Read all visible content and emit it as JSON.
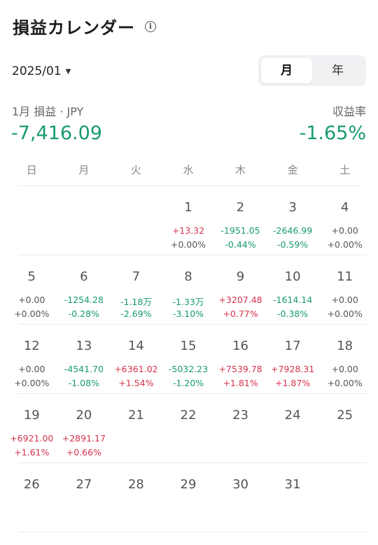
{
  "header": {
    "title": "損益カレンダー",
    "info_icon": "info-icon"
  },
  "month_select": {
    "value": "2025/01"
  },
  "segment": {
    "month": "月",
    "year": "年"
  },
  "summary": {
    "label": "1月 損益 · JPY",
    "rate_label": "収益率",
    "pnl": "-7,416.09",
    "rate": "-1.65%"
  },
  "weekdays": [
    "日",
    "月",
    "火",
    "水",
    "木",
    "金",
    "土"
  ],
  "weeks": [
    [
      {
        "day": "",
        "pnl": "",
        "pct": "",
        "tone": ""
      },
      {
        "day": "",
        "pnl": "",
        "pct": "",
        "tone": ""
      },
      {
        "day": "",
        "pnl": "",
        "pct": "",
        "tone": ""
      },
      {
        "day": "1",
        "pnl": "+13.32",
        "pct": "+0.00%",
        "tone": "red",
        "pct_tone": "gray"
      },
      {
        "day": "2",
        "pnl": "-1951.05",
        "pct": "-0.44%",
        "tone": "green"
      },
      {
        "day": "3",
        "pnl": "-2646.99",
        "pct": "-0.59%",
        "tone": "green"
      },
      {
        "day": "4",
        "pnl": "+0.00",
        "pct": "+0.00%",
        "tone": "gray"
      }
    ],
    [
      {
        "day": "5",
        "pnl": "+0.00",
        "pct": "+0.00%",
        "tone": "gray"
      },
      {
        "day": "6",
        "pnl": "-1254.28",
        "pct": "-0.28%",
        "tone": "green"
      },
      {
        "day": "7",
        "pnl": "-1.18万",
        "pct": "-2.69%",
        "tone": "green"
      },
      {
        "day": "8",
        "pnl": "-1.33万",
        "pct": "-3.10%",
        "tone": "green"
      },
      {
        "day": "9",
        "pnl": "+3207.48",
        "pct": "+0.77%",
        "tone": "red"
      },
      {
        "day": "10",
        "pnl": "-1614.14",
        "pct": "-0.38%",
        "tone": "green"
      },
      {
        "day": "11",
        "pnl": "+0.00",
        "pct": "+0.00%",
        "tone": "gray"
      }
    ],
    [
      {
        "day": "12",
        "pnl": "+0.00",
        "pct": "+0.00%",
        "tone": "gray"
      },
      {
        "day": "13",
        "pnl": "-4541.70",
        "pct": "-1.08%",
        "tone": "green"
      },
      {
        "day": "14",
        "pnl": "+6361.02",
        "pct": "+1.54%",
        "tone": "red"
      },
      {
        "day": "15",
        "pnl": "-5032.23",
        "pct": "-1.20%",
        "tone": "green"
      },
      {
        "day": "16",
        "pnl": "+7539.78",
        "pct": "+1.81%",
        "tone": "red"
      },
      {
        "day": "17",
        "pnl": "+7928.31",
        "pct": "+1.87%",
        "tone": "red"
      },
      {
        "day": "18",
        "pnl": "+0.00",
        "pct": "+0.00%",
        "tone": "gray"
      }
    ],
    [
      {
        "day": "19",
        "pnl": "+6921.00",
        "pct": "+1.61%",
        "tone": "red"
      },
      {
        "day": "20",
        "pnl": "+2891.17",
        "pct": "+0.66%",
        "tone": "red"
      },
      {
        "day": "21",
        "pnl": "",
        "pct": "",
        "tone": ""
      },
      {
        "day": "22",
        "pnl": "",
        "pct": "",
        "tone": ""
      },
      {
        "day": "23",
        "pnl": "",
        "pct": "",
        "tone": ""
      },
      {
        "day": "24",
        "pnl": "",
        "pct": "",
        "tone": ""
      },
      {
        "day": "25",
        "pnl": "",
        "pct": "",
        "tone": ""
      }
    ],
    [
      {
        "day": "26",
        "pnl": "",
        "pct": "",
        "tone": ""
      },
      {
        "day": "27",
        "pnl": "",
        "pct": "",
        "tone": ""
      },
      {
        "day": "28",
        "pnl": "",
        "pct": "",
        "tone": ""
      },
      {
        "day": "29",
        "pnl": "",
        "pct": "",
        "tone": ""
      },
      {
        "day": "30",
        "pnl": "",
        "pct": "",
        "tone": ""
      },
      {
        "day": "31",
        "pnl": "",
        "pct": "",
        "tone": ""
      },
      {
        "day": "",
        "pnl": "",
        "pct": "",
        "tone": ""
      }
    ]
  ],
  "colors": {
    "gain": "#d6334d",
    "loss": "#179b6e",
    "neutral": "#555555"
  }
}
